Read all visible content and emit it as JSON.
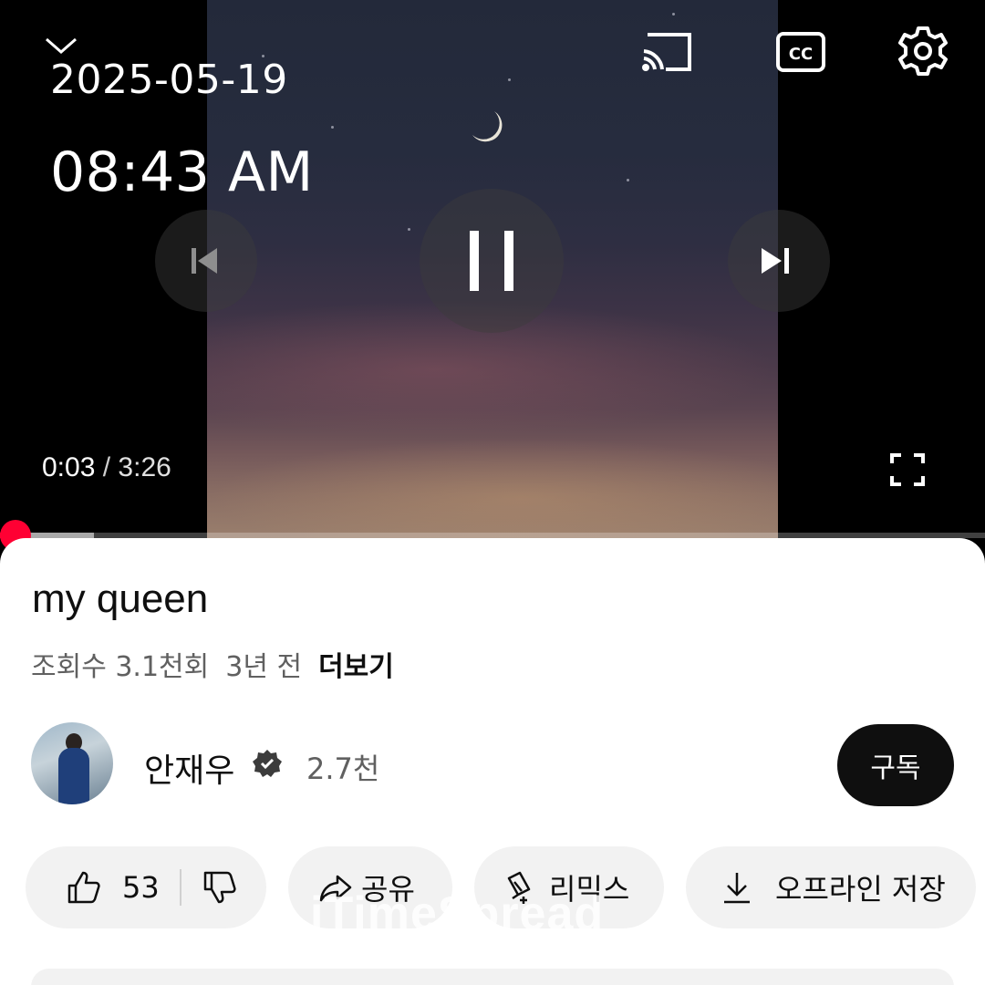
{
  "overlay": {
    "date": "2025-05-19",
    "time": "08:43 AM"
  },
  "player": {
    "current_time": "0:03",
    "separator": "/",
    "duration": "3:26",
    "progress_fraction": 0.0146,
    "buffered_fraction": 0.095,
    "accent_color": "#ff0033",
    "icons": {
      "collapse": "chevron-down-icon",
      "cast": "cast-icon",
      "captions": "cc-icon",
      "settings": "gear-icon",
      "previous": "skip-previous-icon",
      "play_pause": "pause-icon",
      "next": "skip-next-icon",
      "fullscreen": "fullscreen-icon"
    }
  },
  "video": {
    "title": "my queen",
    "views": "조회수 3.1천회",
    "age": "3년 전",
    "more_label": "더보기"
  },
  "channel": {
    "name": "안재우",
    "subscribers": "2.7천",
    "subscribe_label": "구독"
  },
  "actions": {
    "like_count": "53",
    "share_label": "공유",
    "remix_label": "리믹스",
    "offline_label": "오프라인 저장"
  },
  "watermark": "iTimeSpread"
}
